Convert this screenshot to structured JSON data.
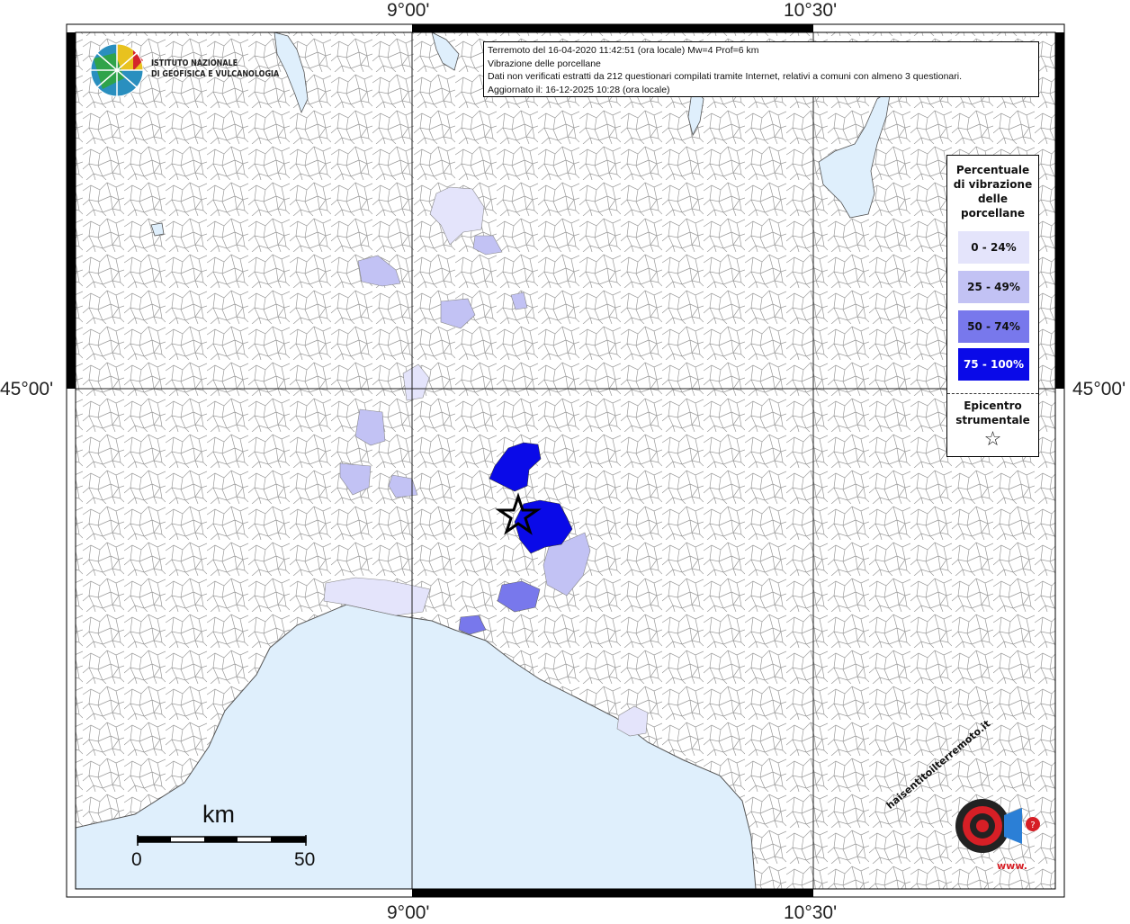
{
  "map": {
    "axis_labels": {
      "lon_left": "9°00'",
      "lon_right": "10°30'",
      "lat": "45°00'"
    }
  },
  "info": {
    "line1": "Terremoto del 16-04-2020 11:42:51 (ora locale) Mw=4 Prof=6 km",
    "line2": "Vibrazione delle porcellane",
    "line3": "Dati non verificati estratti da 212 questionari compilati tramite Internet, relativi a comuni con almeno 3 questionari.",
    "line4": "Aggiornato il: 16-12-2025 10:28 (ora locale)"
  },
  "logo": {
    "line1": "ISTITUTO NAZIONALE",
    "line2": "DI GEOFISICA E VULCANOLOGIA"
  },
  "legend": {
    "title": "Percentuale di vibrazione delle porcellane",
    "items": [
      {
        "label": "0 - 24%",
        "color": "#e4e4fb"
      },
      {
        "label": "25 - 49%",
        "color": "#c2c2f4"
      },
      {
        "label": "50 - 74%",
        "color": "#7878ec"
      },
      {
        "label": "75 - 100%",
        "color": "#0a0ae8"
      }
    ],
    "epicenter_label": "Epicentro strumentale",
    "epicenter_symbol": "☆"
  },
  "scale": {
    "unit": "km",
    "min": "0",
    "max": "50"
  },
  "brand": {
    "text": "haisentitoilterremoto.it",
    "url": "www."
  },
  "colors": {
    "sea": "#dfeffc",
    "border": "#555555"
  }
}
